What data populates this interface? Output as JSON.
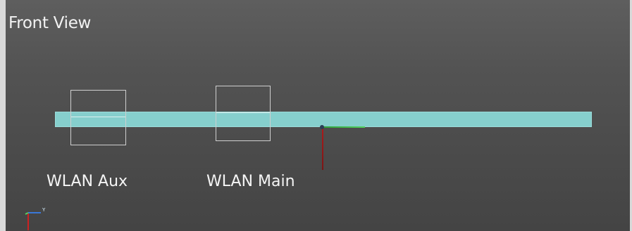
{
  "view": {
    "title": "Front View"
  },
  "antennas": {
    "aux_label": "WLAN Aux",
    "main_label": "WLAN Main"
  },
  "triad": {
    "y_label": "Y"
  },
  "colors": {
    "board": "#86cfcd",
    "background_top": "#5e5e5e",
    "background_bottom": "#444444",
    "x_axis": "#53d260",
    "z_axis": "#b01a1a",
    "y_axis": "#3a78d8"
  }
}
